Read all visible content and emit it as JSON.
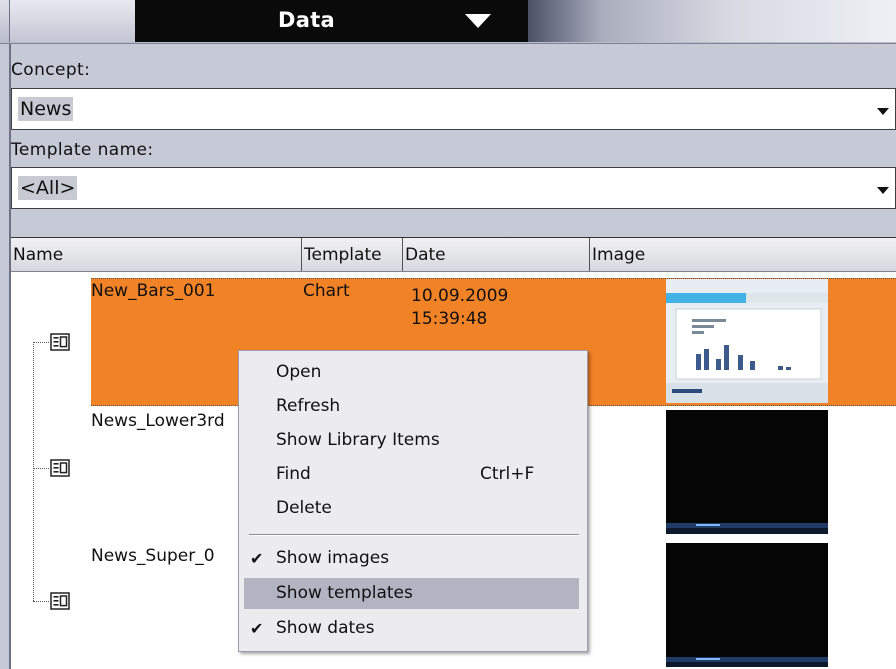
{
  "titlebar": {
    "title": "Data",
    "dropdown_icon": "triangle-down-icon"
  },
  "filters": {
    "concept_label": "Concept:",
    "concept_value": "News",
    "template_label": "Template name:",
    "template_value": "<All>"
  },
  "grid": {
    "columns": [
      "Name",
      "Template",
      "Date",
      "Image"
    ],
    "rows": [
      {
        "name": "New_Bars_001",
        "template": "Chart",
        "date": "10.09.2009",
        "time": "15:39:48",
        "selected": true
      },
      {
        "name": "News_Lower3rd",
        "template": "",
        "date": "",
        "time": "",
        "selected": false
      },
      {
        "name": "News_Super_0",
        "template": "",
        "date": "",
        "time": "",
        "selected": false
      }
    ]
  },
  "context_menu": {
    "items": [
      {
        "label": "Open",
        "shortcut": ""
      },
      {
        "label": "Refresh",
        "shortcut": ""
      },
      {
        "label": "Show Library Items",
        "shortcut": ""
      },
      {
        "label": "Find",
        "shortcut": "Ctrl+F"
      },
      {
        "label": "Delete",
        "shortcut": ""
      },
      {
        "label": "Show images",
        "checked": true
      },
      {
        "label": "Show templates",
        "checked": false,
        "highlighted": true
      },
      {
        "label": "Show dates",
        "checked": true
      }
    ]
  },
  "colors": {
    "selection": "#f28226",
    "menu_highlight": "#b2b4c1",
    "title_bg": "#0a0a0a"
  }
}
